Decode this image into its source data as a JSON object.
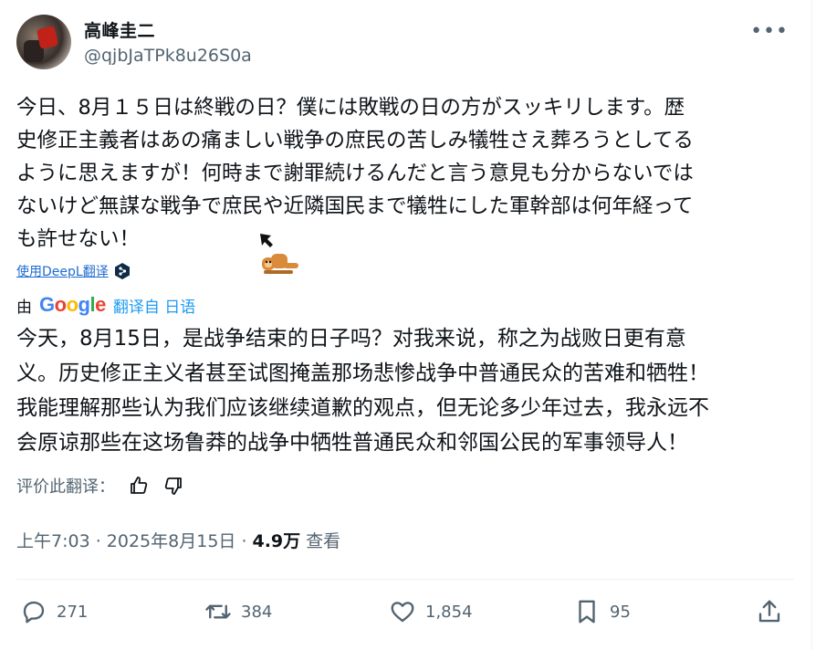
{
  "author": {
    "name": "高峰圭二",
    "handle": "@qjbJaTPk8u26S0a"
  },
  "post": {
    "text": "今日、8月１５日は終戦の日？僕には敗戦の日の方がスッキリします。歴\n史修正主義者はあの痛ましい戦争の庶民の苦しみ犠牲さえ葬ろうとしてる\nように思えますが！何時まで謝罪続けるんだと言う意見も分からないでは\nないけど無謀な戦争で庶民や近隣国民まで犠牲にした軍幹部は何年経って\nも許せない！"
  },
  "translation": {
    "deepl_link": "使用DeepL翻译",
    "by_label": "由",
    "google_logo": [
      "G",
      "o",
      "o",
      "g",
      "l",
      "e"
    ],
    "translated_from": "翻译自 日语",
    "text": "今天，8月15日，是战争结束的日子吗？对我来说，称之为战败日更有意\n义。历史修正主义者甚至试图掩盖那场悲惨战争中普通民众的苦难和牺牲！\n我能理解那些认为我们应该继续道歉的观点，但无论多少年过去，我永远不\n会原谅那些在这场鲁莽的战争中牺牲普通民众和邻国公民的军事领导人！",
    "rate_label": "评价此翻译："
  },
  "meta": {
    "time_date": "上午7:03 · 2025年8月15日 ·",
    "views_count": "4.9万",
    "views_label": "查看"
  },
  "actions": {
    "replies": "271",
    "reposts": "384",
    "likes": "1,854",
    "bookmarks": "95"
  },
  "icons": {
    "more": "more-horizontal-icon",
    "reply": "reply-bubble-icon",
    "repost": "repost-arrows-icon",
    "like": "heart-icon",
    "bookmark": "bookmark-icon",
    "share": "share-upload-icon",
    "thumbs_up": "thumbs-up-icon",
    "thumbs_down": "thumbs-down-icon"
  },
  "colors": {
    "link": "#1d9bf0",
    "secondary": "#536471",
    "text": "#0f1419"
  }
}
